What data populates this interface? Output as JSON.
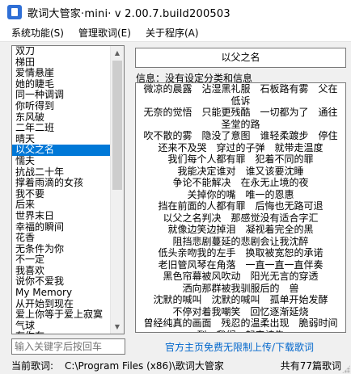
{
  "window": {
    "title": "歌词大管家·mini· v 2.00.7.build200503"
  },
  "menu": [
    {
      "label": "系统功能(S)"
    },
    {
      "label": "管理歌词(E)"
    },
    {
      "label": "关于程序(A)"
    }
  ],
  "song_list": {
    "selected_index": 10,
    "items": [
      "双刀",
      "梯田",
      "爱情悬崖",
      "她的睫毛",
      "同一种调调",
      "你听得到",
      "东风破",
      "二年二班",
      "晴天",
      "以父之名",
      "懦夫",
      "抗战二十年",
      "撑着雨滴的女孩",
      "我不要",
      "后来",
      "世界末日",
      "幸福的瞬间",
      "花香",
      "无条件为你",
      "不一定",
      "我喜欢",
      "说你不爱我",
      "My Memory",
      "从开始到现在",
      "爱上你等于爱上寂寞",
      "气球",
      "有你在"
    ]
  },
  "song_title": "以父之名",
  "info_text": "信息：没有设定分类和信息",
  "lyrics": [
    "微凉的晨露　沾湿黑礼服　石板路有雾　父在",
    "低诉",
    "无奈的觉悟　只能更残酷　一切都为了　通往",
    "圣堂的路",
    "吹不散的雾　隐没了意图　谁轻柔踱步　停住",
    "还来不及哭　穿过的子弹　就带走温度",
    "我们每个人都有罪　犯着不同的罪",
    "我能决定谁对　谁又该要沈睡",
    "争论不能解决　在永无止境的夜",
    "关掉你的嘴　唯一的恩惠",
    "挡在前面的人都有罪　后悔也无路可退",
    "以父之名判决　那感觉没有适合字汇",
    "就像边笑边掉泪　凝视着完全的黑",
    "阻挡悲剧蔓延的悲剧会让我沈醉",
    "低头亲吻我的左手　换取被宽恕的承诺",
    "老旧管风琴在角落　一直一直一直伴奏",
    "黑色帘幕被风吹动　阳光无言的穿透",
    "洒向那群被我驯服后的　兽",
    "沈默的喊叫　沈默的喊叫　孤单开始发酵",
    "不停对着我嘲笑　回忆逐渐延烧",
    "曾经纯真的画面　残忍的温柔出现　脆弱时间",
    "到　我们一起来祷告",
    "#仁慈的父我已坠入　看不见罪的国度　请原"
  ],
  "search": {
    "placeholder": "输入关键字后按回车"
  },
  "upload_link": "官方主页免费无限制上传/下载歌词",
  "status": {
    "label": "当前歌词:",
    "path": "C:\\Program Files (x86)\\歌词大管家",
    "count": "共有77篇歌词"
  },
  "colors": {
    "selection": "#0078d7",
    "link": "#0066cc"
  }
}
